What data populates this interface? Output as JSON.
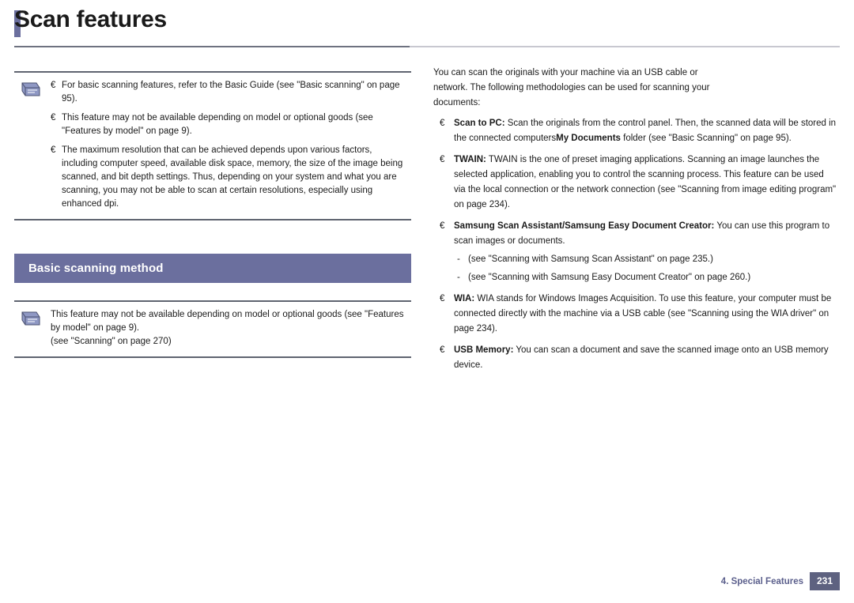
{
  "header": {
    "title": "Scan features"
  },
  "left": {
    "note1": {
      "icon": "note-icon",
      "lines": [
        "For basic scanning features, refer to the Basic Guide (see \"Basic scanning\" on page 95).",
        "This feature may not be available depending on model or optional goods (see \"Features by model\" on page 9)."
      ],
      "bullets": [
        {
          "text": "The maximum resolution that can be achieved depends upon various factors, including computer speed, available disk space, memory, the size of the image being scanned, and bit depth settings. Thus, depending on your system and what you are scanning, you may not be able to scan at certain resolutions, especially using enhanced dpi."
        }
      ]
    },
    "section_heading": "Basic scanning method",
    "note2": {
      "icon": "note-icon",
      "lines": [
        "This feature may not be available depending on model or optional goods (see \"Features by model\" on page 9).",
        "(see \"Scanning\" on page 270)"
      ]
    }
  },
  "right": {
    "intro": [
      "You can scan the originals with your machine via an USB cable or",
      "network. The following methodologies can be used for scanning your",
      "documents:"
    ],
    "items": [
      {
        "label": "Scan to PC:",
        "text": " Scan the originals from the control panel. Then, the scanned data will be stored in the connected computers",
        "bold_tail": "My Documents",
        "tail": " folder (see \"Basic Scanning\" on page 95).",
        "euro": "€"
      },
      {
        "label": "TWAIN:",
        "text": " TWAIN is the one of preset imaging applications. Scanning an image launches the selected application, enabling you to control the scanning process. This feature can be used via the local connection or the network connection (see \"Scanning from image editing program\" on page 234).",
        "euro": "€"
      },
      {
        "label": "Samsung Scan Assistant/Samsung Easy Document Creator:",
        "text": " You can use this program to scan images or documents.",
        "euro": "€",
        "sub": [
          "(see \"Scanning with Samsung Scan Assistant\" on page 235.)",
          "(see \"Scanning with Samsung Easy Document Creator\" on page 260.)"
        ]
      },
      {
        "label": "WIA:",
        "text": " WIA stands for Windows Images Acquisition. To use this feature, your computer must be connected directly with the machine via a USB cable (see \"Scanning using the WIA driver\" on page 234).",
        "euro": "€"
      },
      {
        "label": "USB Memory:",
        "text": " You can scan a document and save the scanned image onto an USB memory device.",
        "euro": "€"
      }
    ]
  },
  "footer": {
    "chapter": "4. Special Features",
    "page": "231"
  }
}
